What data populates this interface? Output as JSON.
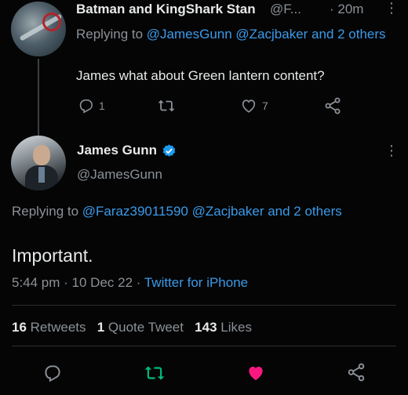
{
  "reply_tweet": {
    "author_name": "Batman and KingShark Stan",
    "author_handle": "@F...",
    "time": "· 20m",
    "replying_prefix": "Replying to ",
    "replying_mentions": "@JamesGunn @Zacjbaker and 2 others",
    "text": "James what about Green lantern content?",
    "reply_count": "1",
    "like_count": "7"
  },
  "main_tweet": {
    "author_name": "James Gunn",
    "author_handle": "@JamesGunn",
    "replying_prefix": "Replying to ",
    "replying_mentions": "@Faraz39011590 @Zacjbaker and 2 others",
    "text": "Important.",
    "time": "5:44 pm · 10 Dec 22 · ",
    "source": "Twitter for iPhone",
    "stats": {
      "retweets_count": "16",
      "retweets_label": "Retweets",
      "quotes_count": "1",
      "quotes_label": "Quote Tweet",
      "likes_count": "143",
      "likes_label": "Likes"
    }
  },
  "icons": [
    "reply-icon",
    "retweet-icon",
    "like-icon",
    "share-icon",
    "more-icon",
    "verified-icon"
  ],
  "colors": {
    "background": "#050505",
    "link": "#3b9ae9",
    "muted": "#8b9197",
    "retweeted": "#00ba7c",
    "liked": "#f91880"
  }
}
